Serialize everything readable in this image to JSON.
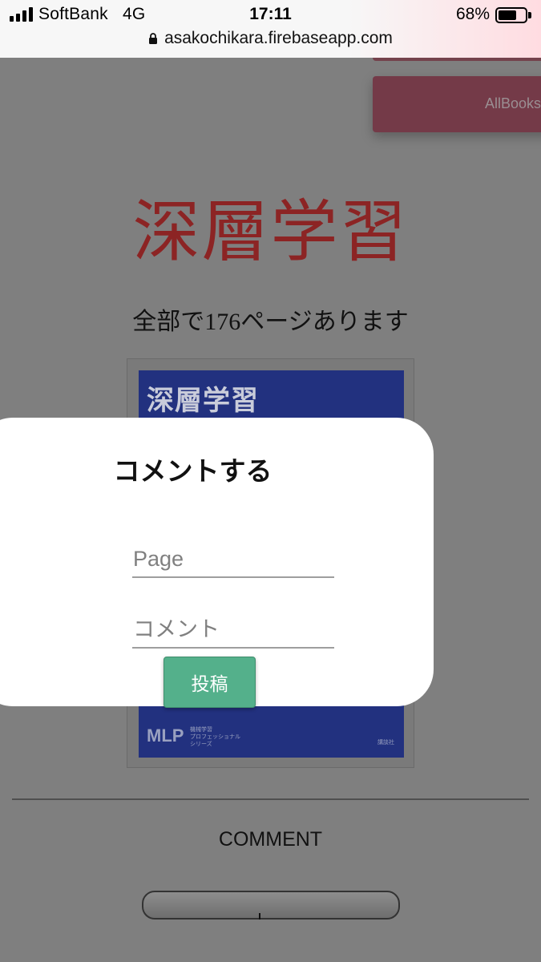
{
  "status_bar": {
    "carrier": "SoftBank",
    "network": "4G",
    "time": "17:11",
    "battery_percent": "68%",
    "battery_level": 0.68,
    "url": "asakochikara.firebaseapp.com"
  },
  "page": {
    "allbooks_label": "AllBooks",
    "book_title": "深層学習",
    "page_count_text": "全部で176ページあります",
    "cover": {
      "title": "深層学習",
      "logo": "MLP",
      "series_line1": "機械学習",
      "series_line2": "プロフェッショナル",
      "series_line3": "シリーズ",
      "publisher": "講談社"
    },
    "comment_heading": "COMMENT"
  },
  "modal": {
    "title": "コメントする",
    "page_placeholder": "Page",
    "comment_placeholder": "コメント",
    "submit_label": "投稿"
  },
  "colors": {
    "overlay": "#7f7f7f",
    "title_red": "#8c2424",
    "submit_green": "#54b08b",
    "allbooks_button": "#743a48",
    "cover_blue": "#22317f"
  }
}
